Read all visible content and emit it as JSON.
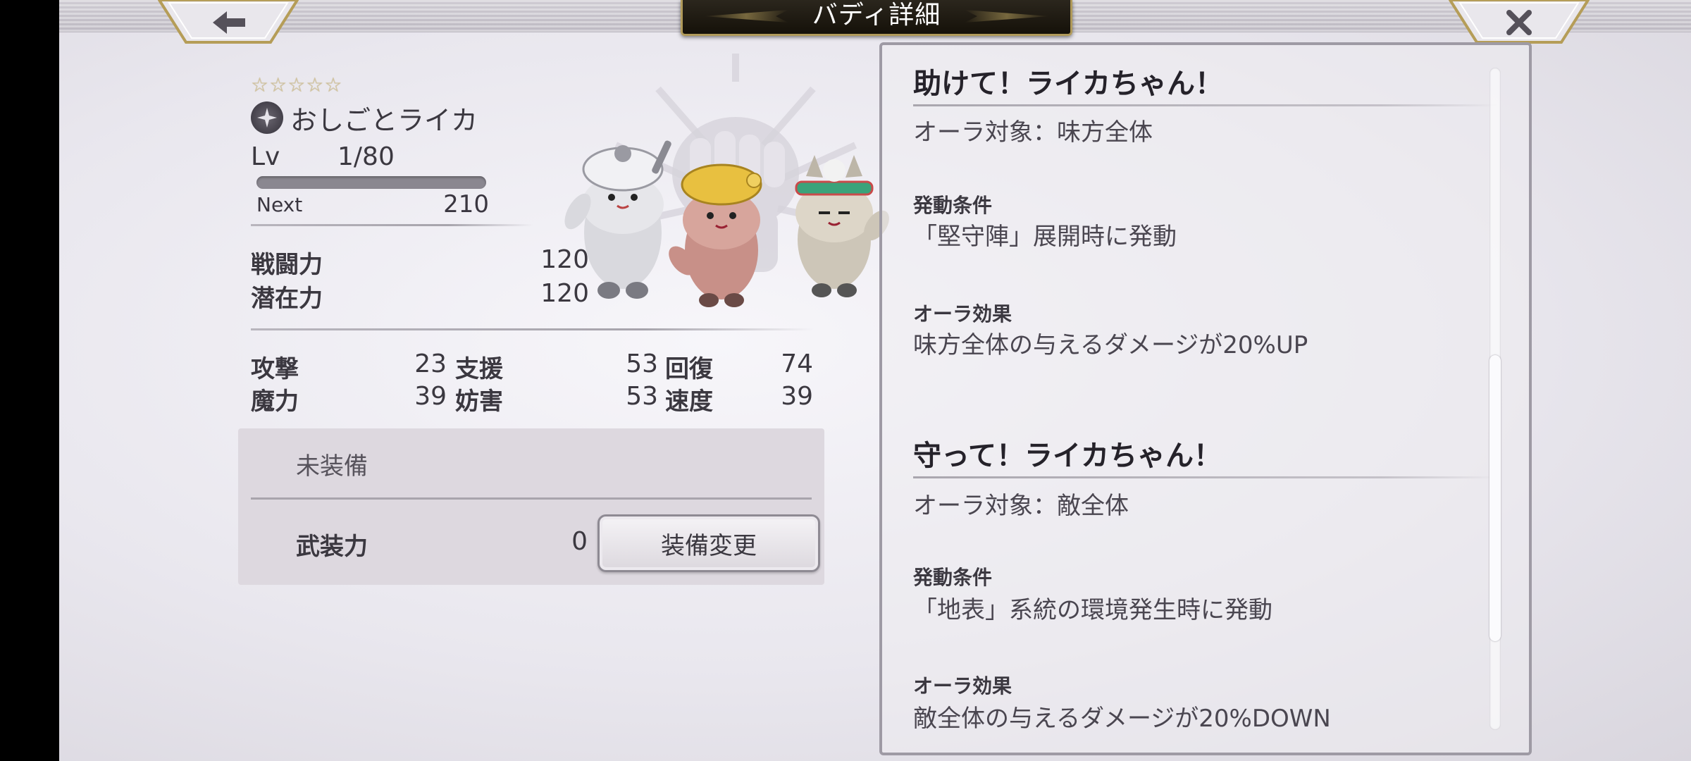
{
  "header": {
    "title": "バディ詳細",
    "back_icon": "arrow-left-icon",
    "close_icon": "close-icon"
  },
  "buddy": {
    "stars": "☆☆☆☆☆",
    "rarity_stars": 5,
    "element_icon": "element-icon",
    "name": "おしごとライカ",
    "lv_label": "Lv",
    "lv_value": "1/80",
    "exp_progress": 0.0,
    "next_label": "Next",
    "next_value": "210",
    "power_label": "戦闘力",
    "power_value": "120",
    "potential_label": "潜在力",
    "potential_value": "120"
  },
  "stats": [
    {
      "label": "攻撃",
      "value": "23"
    },
    {
      "label": "支援",
      "value": "53"
    },
    {
      "label": "回復",
      "value": "74"
    },
    {
      "label": "魔力",
      "value": "39"
    },
    {
      "label": "妨害",
      "value": "53"
    },
    {
      "label": "速度",
      "value": "39"
    }
  ],
  "equipment": {
    "status": "未装備",
    "armament_label": "武装力",
    "armament_value": "0",
    "change_button": "装備変更"
  },
  "skills": [
    {
      "title": "助けて！ライカちゃん！",
      "aura_target": "オーラ対象：味方全体",
      "condition_header": "発動条件",
      "condition": "「堅守陣」展開時に発動",
      "effect_header": "オーラ効果",
      "effect": "味方全体の与えるダメージが20%UP"
    },
    {
      "title": "守って！ライカちゃん！",
      "aura_target": "オーラ対象：敵全体",
      "condition_header": "発動条件",
      "condition": "「地表」系統の環境発生時に発動",
      "effect_header": "オーラ効果",
      "effect": "敵全体の与えるダメージが20%DOWN"
    }
  ],
  "colors": {
    "title_plate": "#1e1a12",
    "gold_trim": "#b09a5a",
    "panel_border": "#9e9aa4"
  }
}
